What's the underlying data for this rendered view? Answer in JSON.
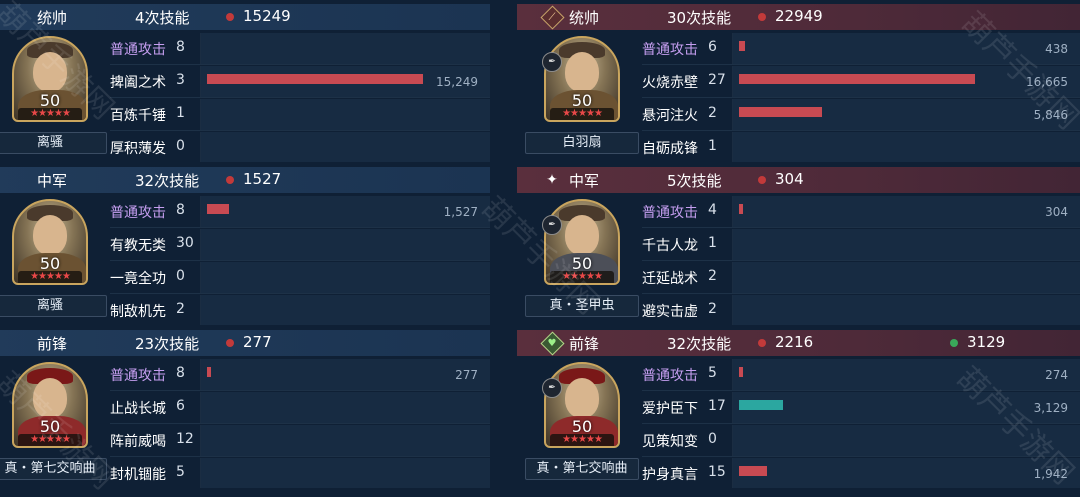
{
  "panels": [
    {
      "id": "l0",
      "role": "统帅",
      "skill_count": "4次技能",
      "damage": "15249",
      "heal": "",
      "level": "50",
      "stars": "★★★★★",
      "gear": "离骚",
      "skills": [
        {
          "name": "普通攻击",
          "uses": "8",
          "value": 0,
          "display": ""
        },
        {
          "name": "捭阖之术",
          "uses": "3",
          "value": 15249,
          "display": "15,249"
        },
        {
          "name": "百炼千锤",
          "uses": "1",
          "value": 0,
          "display": ""
        },
        {
          "name": "厚积薄发",
          "uses": "0",
          "value": 0,
          "display": ""
        }
      ]
    },
    {
      "id": "l1",
      "role": "中军",
      "skill_count": "32次技能",
      "damage": "1527",
      "heal": "",
      "level": "50",
      "stars": "★★★★★",
      "gear": "离骚",
      "skills": [
        {
          "name": "普通攻击",
          "uses": "8",
          "value": 1527,
          "display": "1,527"
        },
        {
          "name": "有教无类",
          "uses": "30",
          "value": 0,
          "display": ""
        },
        {
          "name": "一竟全功",
          "uses": "0",
          "value": 0,
          "display": ""
        },
        {
          "name": "制敌机先",
          "uses": "2",
          "value": 0,
          "display": ""
        }
      ]
    },
    {
      "id": "l2",
      "role": "前锋",
      "skill_count": "23次技能",
      "damage": "277",
      "heal": "",
      "level": "50",
      "stars": "★★★★★",
      "gear": "真・第七交响曲",
      "skills": [
        {
          "name": "普通攻击",
          "uses": "8",
          "value": 277,
          "display": "277"
        },
        {
          "name": "止战长城",
          "uses": "6",
          "value": 0,
          "display": ""
        },
        {
          "name": "阵前威喝",
          "uses": "12",
          "value": 0,
          "display": ""
        },
        {
          "name": "封机锢能",
          "uses": "5",
          "value": 0,
          "display": ""
        }
      ]
    },
    {
      "id": "r0",
      "role": "统帅",
      "skill_count": "30次技能",
      "damage": "22949",
      "heal": "",
      "level": "50",
      "stars": "★★★★★",
      "gear": "白羽扇",
      "skills": [
        {
          "name": "普通攻击",
          "uses": "6",
          "value": 438,
          "display": "438"
        },
        {
          "name": "火烧赤壁",
          "uses": "27",
          "value": 16665,
          "display": "16,665"
        },
        {
          "name": "悬河注火",
          "uses": "2",
          "value": 5846,
          "display": "5,846"
        },
        {
          "name": "自砺成锋",
          "uses": "1",
          "value": 0,
          "display": ""
        }
      ]
    },
    {
      "id": "r1",
      "role": "中军",
      "skill_count": "5次技能",
      "damage": "304",
      "heal": "",
      "level": "50",
      "stars": "★★★★★",
      "gear": "真・圣甲虫",
      "skills": [
        {
          "name": "普通攻击",
          "uses": "4",
          "value": 304,
          "display": "304"
        },
        {
          "name": "千古人龙",
          "uses": "1",
          "value": 0,
          "display": ""
        },
        {
          "name": "迁延战术",
          "uses": "2",
          "value": 0,
          "display": ""
        },
        {
          "name": "避实击虚",
          "uses": "2",
          "value": 0,
          "display": ""
        }
      ]
    },
    {
      "id": "r2",
      "role": "前锋",
      "skill_count": "32次技能",
      "damage": "2216",
      "heal": "3129",
      "level": "50",
      "stars": "★★★★★",
      "gear": "真・第七交响曲",
      "skills": [
        {
          "name": "普通攻击",
          "uses": "5",
          "value": 274,
          "display": "274"
        },
        {
          "name": "爱护臣下",
          "uses": "17",
          "value": 3129,
          "display": "3,129",
          "heal": true
        },
        {
          "name": "见策知变",
          "uses": "0",
          "value": 0,
          "display": ""
        },
        {
          "name": "护身真言",
          "uses": "15",
          "value": 1942,
          "display": "1,942"
        }
      ]
    }
  ],
  "colors": {
    "damage_bar": "#c84a52",
    "heal_bar": "#2ba7a0",
    "basic_attack_text": "#c59ef0"
  },
  "watermark": "葫芦手游网"
}
